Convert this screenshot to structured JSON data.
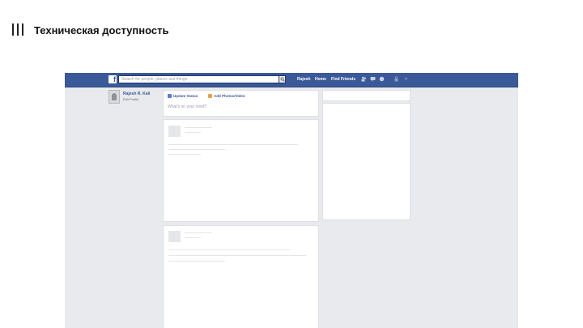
{
  "slide": {
    "title": "Техническая доступность"
  },
  "topbar": {
    "logo_letter": "f",
    "search_placeholder": "Search for people, places and things",
    "nav": {
      "profile": "Rajesh",
      "home": "Home",
      "find_friends": "Find Friends"
    }
  },
  "profile": {
    "name": "Rajesh R. Kali",
    "edit_label": "Edit Profile"
  },
  "composer": {
    "update_status": "Update Status",
    "add_photos": "Add Photos/Video",
    "prompt": "What's on your mind?"
  },
  "colors": {
    "brand": "#3b5998",
    "page_bg": "#e9eaed",
    "placeholder": "#e4e6e9"
  }
}
